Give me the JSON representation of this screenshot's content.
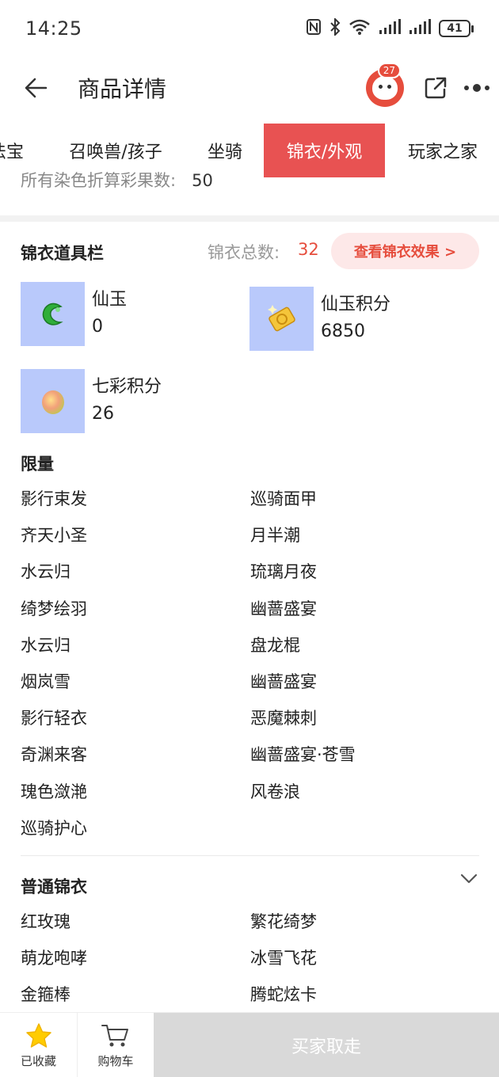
{
  "status_bar": {
    "time": "14:25",
    "battery": "41"
  },
  "header": {
    "title": "商品详情",
    "notification_count": "27"
  },
  "tabs": [
    {
      "label": "法宝"
    },
    {
      "label": "召唤兽/孩子"
    },
    {
      "label": "坐骑"
    },
    {
      "label": "锦衣/外观",
      "active": true
    },
    {
      "label": "玩家之家"
    }
  ],
  "partial_row": {
    "label": "所有染色折算彩果数:",
    "value": "50"
  },
  "costume_bar": {
    "title": "锦衣道具栏",
    "total_label": "锦衣总数:",
    "total_value": "32",
    "effect_button": "查看锦衣效果 >",
    "items": [
      {
        "name": "仙玉",
        "value": "0",
        "icon": "green-jade-icon"
      },
      {
        "name": "仙玉积分",
        "value": "6850",
        "icon": "jade-points-card-icon"
      },
      {
        "name": "七彩积分",
        "value": "26",
        "icon": "rainbow-orb-icon"
      }
    ]
  },
  "limited": {
    "title": "限量",
    "left": [
      "影行束发",
      "齐天小圣",
      "水云归",
      "绮梦绘羽",
      "水云归",
      "烟岚雪",
      "影行轻衣",
      "奇渊来客",
      "瑰色潋滟",
      "巡骑护心"
    ],
    "right": [
      "巡骑面甲",
      "月半潮",
      "琉璃月夜",
      "幽蔷盛宴",
      "盘龙棍",
      "幽蔷盛宴",
      "恶魔棘刺",
      "幽蔷盛宴·苍雪",
      "风卷浪"
    ]
  },
  "normal": {
    "title": "普通锦衣",
    "left": [
      "红玫瑰",
      "萌龙咆哮",
      "金箍棒"
    ],
    "right": [
      "繁花绮梦",
      "冰雪飞花",
      "腾蛇炫卡"
    ]
  },
  "bottom_bar": {
    "favorite_label": "已收藏",
    "cart_label": "购物车",
    "buy_label": "买家取走"
  },
  "colors": {
    "accent": "#e85252",
    "thumb_bg": "#b9c9fb",
    "favorite": "#ffcc00"
  }
}
